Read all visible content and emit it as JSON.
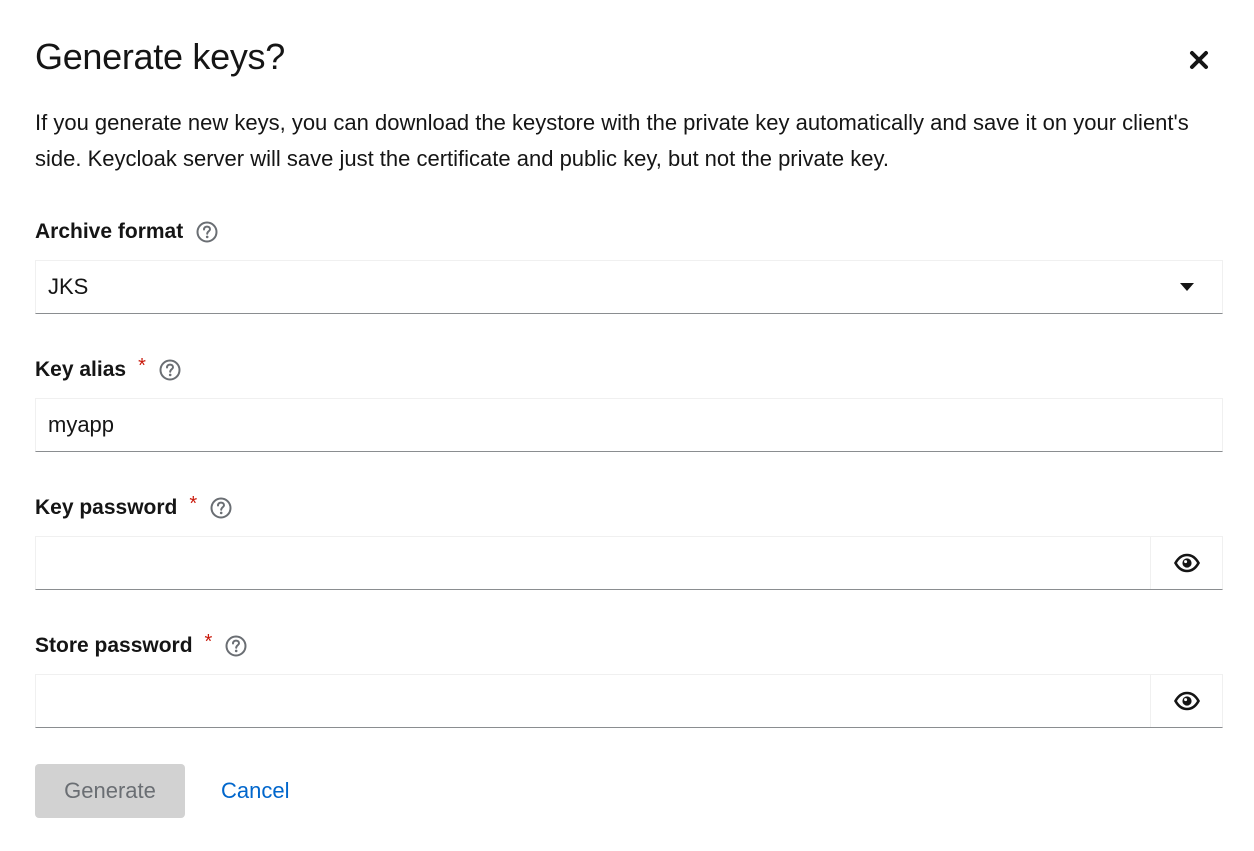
{
  "modal": {
    "title": "Generate keys?",
    "description": "If you generate new keys, you can download the keystore with the private key automatically and save it on your client's side. Keycloak server will save just the certificate and public key, but not the private key."
  },
  "fields": {
    "archive_format": {
      "label": "Archive format",
      "value": "JKS"
    },
    "key_alias": {
      "label": "Key alias",
      "required_mark": "*",
      "value": "myapp"
    },
    "key_password": {
      "label": "Key password",
      "required_mark": "*",
      "value": ""
    },
    "store_password": {
      "label": "Store password",
      "required_mark": "*",
      "value": ""
    }
  },
  "actions": {
    "generate_label": "Generate",
    "generate_disabled": true,
    "cancel_label": "Cancel"
  },
  "icons": {
    "close": "close-icon",
    "help": "help-icon",
    "caret": "caret-down-icon",
    "eye": "eye-icon"
  },
  "colors": {
    "required": "#c9190b",
    "link": "#0066cc",
    "disabled_button_bg": "#d2d2d2",
    "disabled_button_text": "#6a6e73"
  }
}
